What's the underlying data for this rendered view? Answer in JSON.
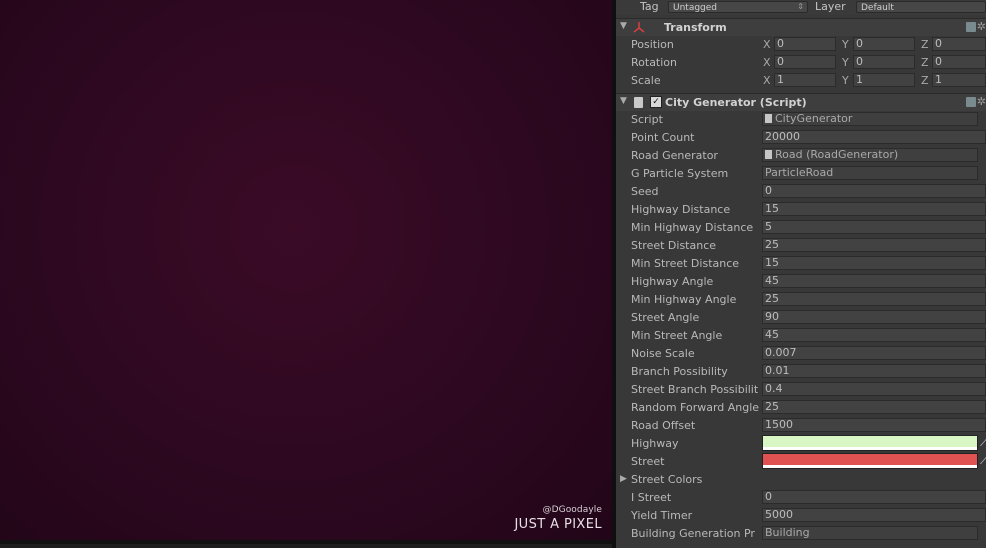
{
  "scene": {
    "watermark_handle": "@DGoodayle",
    "watermark_brand": "JUST A PIXEL"
  },
  "tag_row": {
    "tag_label": "Tag",
    "tag_value": "Untagged",
    "layer_label": "Layer",
    "layer_value": "Default"
  },
  "transform": {
    "title": "Transform",
    "rows": [
      {
        "label": "Position",
        "x": "0",
        "y": "0",
        "z": "0"
      },
      {
        "label": "Rotation",
        "x": "0",
        "y": "0",
        "z": "0"
      },
      {
        "label": "Scale",
        "x": "1",
        "y": "1",
        "z": "1"
      }
    ],
    "axes": {
      "x": "X",
      "y": "Y",
      "z": "Z"
    }
  },
  "city_generator": {
    "title": "City Generator (Script)",
    "enabled": true,
    "fields": [
      {
        "label": "Script",
        "value": "CityGenerator"
      },
      {
        "label": "Point Count",
        "value": "20000"
      },
      {
        "label": "Road Generator",
        "value": "Road (RoadGenerator)"
      },
      {
        "label": "G Particle System",
        "value": "ParticleRoad"
      },
      {
        "label": "Seed",
        "value": "0"
      },
      {
        "label": "Highway Distance",
        "value": "15"
      },
      {
        "label": "Min Highway Distance",
        "value": "5"
      },
      {
        "label": "Street Distance",
        "value": "25"
      },
      {
        "label": "Min Street Distance",
        "value": "15"
      },
      {
        "label": "Highway Angle",
        "value": "45"
      },
      {
        "label": "Min Highway Angle",
        "value": "25"
      },
      {
        "label": "Street Angle",
        "value": "90"
      },
      {
        "label": "Min Street Angle",
        "value": "45"
      },
      {
        "label": "Noise Scale",
        "value": "0.007"
      },
      {
        "label": "Branch Possibility",
        "value": "0.01"
      },
      {
        "label": "Street Branch Possibilit",
        "value": "0.4"
      },
      {
        "label": "Random Forward Angle",
        "value": "25"
      },
      {
        "label": "Road Offset",
        "value": "1500"
      }
    ],
    "colors": [
      {
        "label": "Highway",
        "color": "#d9f7c4"
      },
      {
        "label": "Street",
        "color": "#e05252"
      }
    ],
    "street_colors_label": "Street Colors",
    "fields2": [
      {
        "label": "I Street",
        "value": "0"
      },
      {
        "label": "Yield Timer",
        "value": "5000"
      },
      {
        "label": "Building Generation Pr",
        "value": "Building"
      }
    ]
  }
}
